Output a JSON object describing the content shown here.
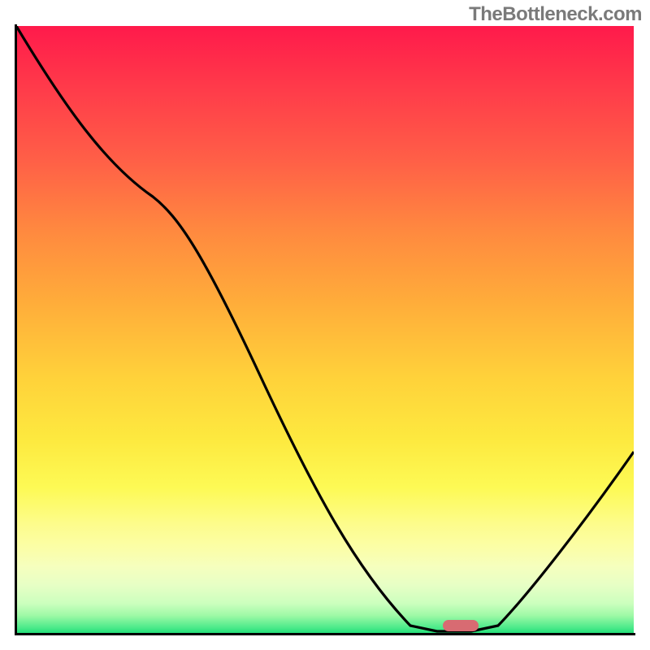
{
  "watermark": "TheBottleneck.com",
  "chart_data": {
    "type": "line",
    "title": "",
    "xlabel": "",
    "ylabel": "",
    "xlim": [
      0,
      100
    ],
    "ylim": [
      0,
      100
    ],
    "grid": false,
    "background": "vertical gradient red→orange→yellow→green (bottleneck severity colormap)",
    "series": [
      {
        "name": "bottleneck-curve",
        "x": [
          0,
          12,
          22,
          56,
          68,
          74,
          78,
          100
        ],
        "values": [
          100,
          82,
          72,
          15,
          1,
          0,
          1,
          30
        ]
      }
    ],
    "marker": {
      "name": "optimal-range",
      "x_start": 68,
      "x_end": 76,
      "y": 0,
      "color": "#d86b72"
    }
  },
  "colors": {
    "curve": "#000000",
    "marker": "#d86b72",
    "axis": "#000000",
    "watermark": "#7a7a7a"
  }
}
